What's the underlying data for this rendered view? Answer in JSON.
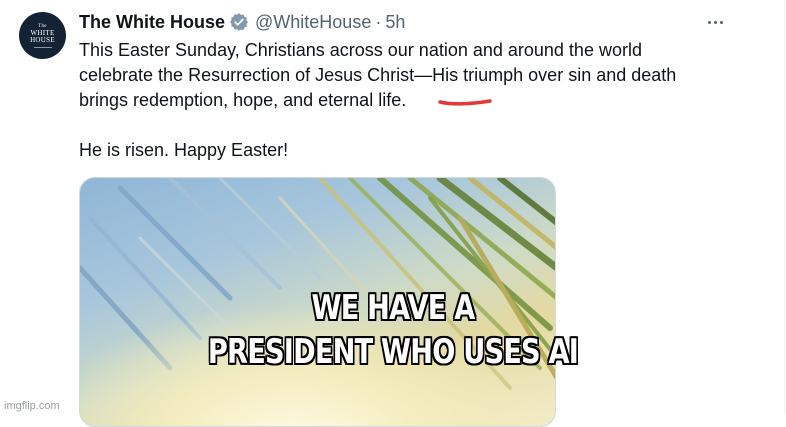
{
  "tweet": {
    "display_name": "The White House",
    "handle": "@WhiteHouse",
    "separator": "·",
    "time": "5h",
    "avatar_logo_lines": [
      "The",
      "WHITE",
      "HOUSE"
    ],
    "text_lines": [
      "This Easter Sunday, Christians across our nation and around the world",
      "celebrate the Resurrection of Jesus Christ—His triumph over sin and death",
      "brings redemption, hope, and eternal life."
    ],
    "text_line_2": "He is risen. Happy Easter!",
    "verified_color": "#536471",
    "annotation_color": "#e53935"
  },
  "meme": {
    "caption_line_1": "WE HAVE A",
    "caption_line_2": "PRESIDENT WHO USES AI"
  },
  "watermark": "imgflip.com",
  "icons": {
    "verified": "verified-badge-icon",
    "more": "more-horizontal-icon"
  }
}
